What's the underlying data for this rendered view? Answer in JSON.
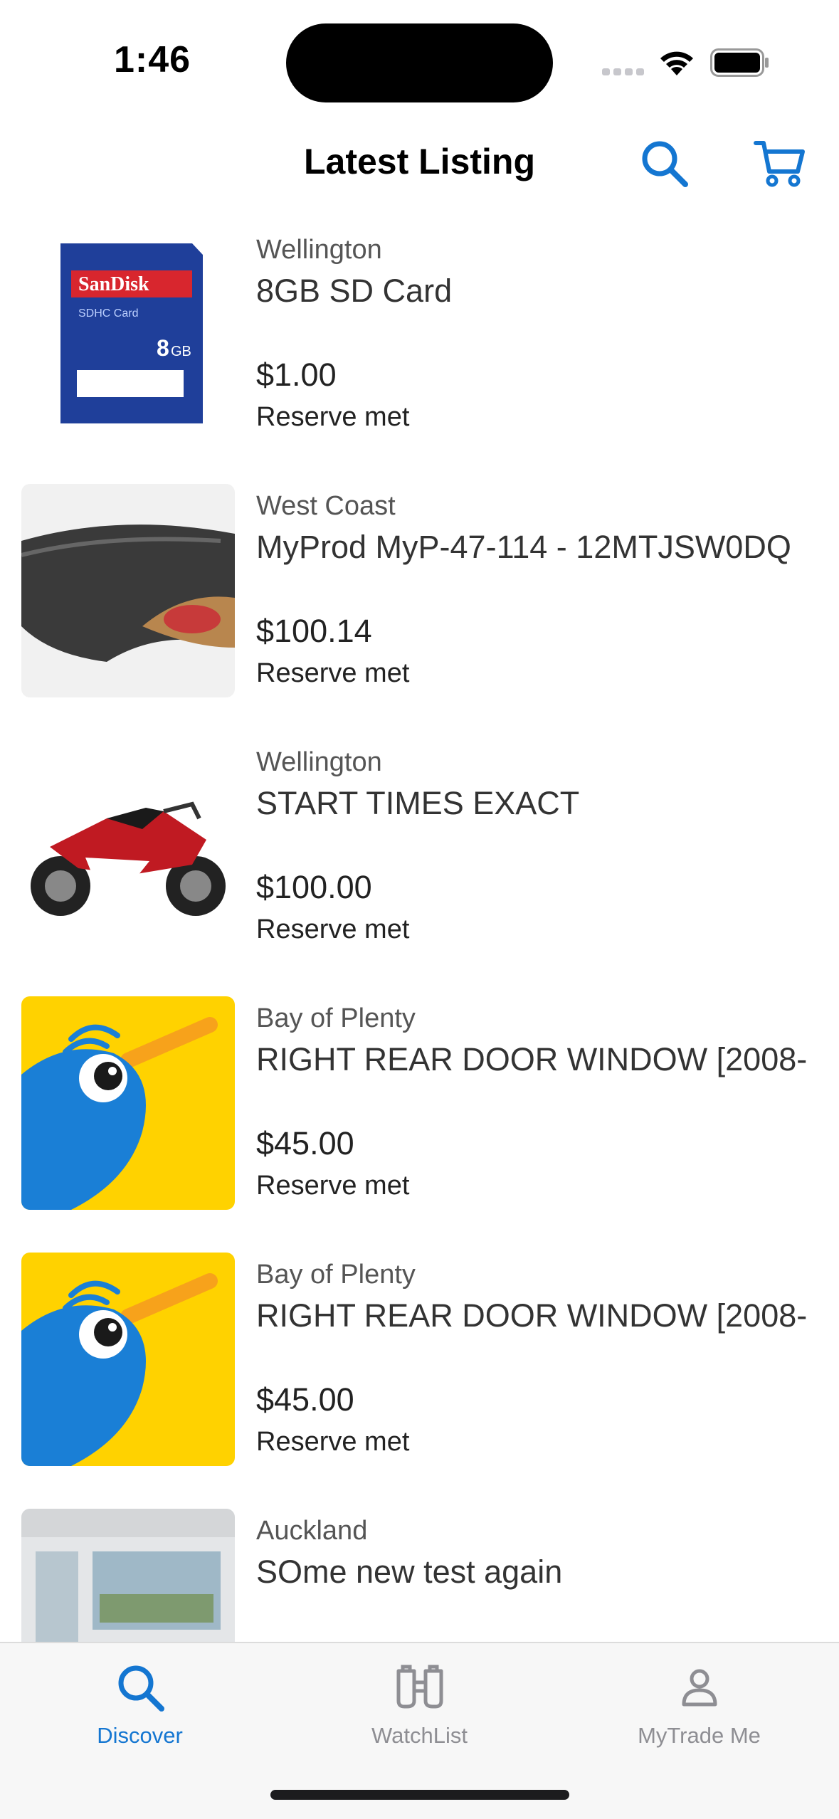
{
  "status_bar": {
    "time": "1:46"
  },
  "nav": {
    "title": "Latest Listing",
    "search_icon": "search-icon",
    "cart_icon": "cart-icon"
  },
  "colors": {
    "accent": "#1476D1",
    "inactive": "#8E8E93",
    "kiwi_yellow": "#FFD200",
    "kiwi_blue": "#1A7FD6"
  },
  "listings": [
    {
      "region": "Wellington",
      "title": "8GB SD Card",
      "price": "$1.00",
      "reserve": "Reserve met",
      "image": "sd-card-image"
    },
    {
      "region": "West Coast",
      "title": "MyProd MyP-47-114 - 12MTJSW0DQ",
      "price": "$100.14",
      "reserve": "Reserve met",
      "image": "product-image"
    },
    {
      "region": "Wellington",
      "title": "START TIMES EXACT",
      "price": "$100.00",
      "reserve": "Reserve met",
      "image": "motorcycle-image"
    },
    {
      "region": "Bay of Plenty",
      "title": "RIGHT REAR DOOR WINDOW [2008-",
      "price": "$45.00",
      "reserve": "Reserve met",
      "image": "kiwi-placeholder-image"
    },
    {
      "region": "Bay of Plenty",
      "title": "RIGHT REAR DOOR WINDOW [2008-",
      "price": "$45.00",
      "reserve": "Reserve met",
      "image": "kiwi-placeholder-image"
    },
    {
      "region": "Auckland",
      "title": "SOme new test again",
      "price": "",
      "reserve": "",
      "image": "house-interior-image"
    }
  ],
  "tabs": [
    {
      "label": "Discover",
      "icon": "search-icon",
      "active": true
    },
    {
      "label": "WatchList",
      "icon": "binoculars-icon",
      "active": false
    },
    {
      "label": "MyTrade Me",
      "icon": "person-icon",
      "active": false
    }
  ]
}
